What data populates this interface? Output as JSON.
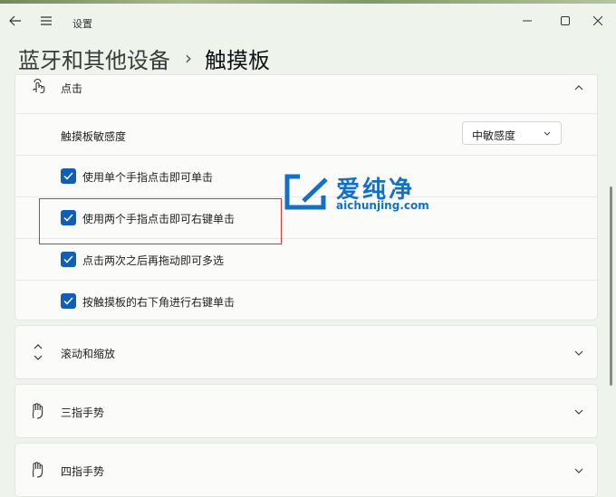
{
  "window": {
    "app_title": "设置"
  },
  "breadcrumb": {
    "parent": "蓝牙和其他设备",
    "separator": "›",
    "current": "触摸板"
  },
  "taps_section": {
    "header": "点击",
    "sensitivity_label": "触摸板敏感度",
    "sensitivity_value": "中敏感度",
    "options": [
      {
        "label": "使用单个手指点击即可单击",
        "checked": true
      },
      {
        "label": "使用两个手指点击即可右键单击",
        "checked": true
      },
      {
        "label": "点击两次之后再拖动即可多选",
        "checked": true
      },
      {
        "label": "按触摸板的右下角进行右键单击",
        "checked": true
      }
    ]
  },
  "sections": [
    {
      "label": "滚动和缩放",
      "icon": "scroll-zoom-icon"
    },
    {
      "label": "三指手势",
      "icon": "three-finger-hand-icon"
    },
    {
      "label": "四指手势",
      "icon": "four-finger-hand-icon"
    }
  ],
  "watermark": {
    "text_cn": "爱纯净",
    "text_en": "aichunjing.com"
  },
  "colors": {
    "accent": "#0f5fb6",
    "highlight_box": "#d9362b",
    "watermark": "#1271c5"
  }
}
